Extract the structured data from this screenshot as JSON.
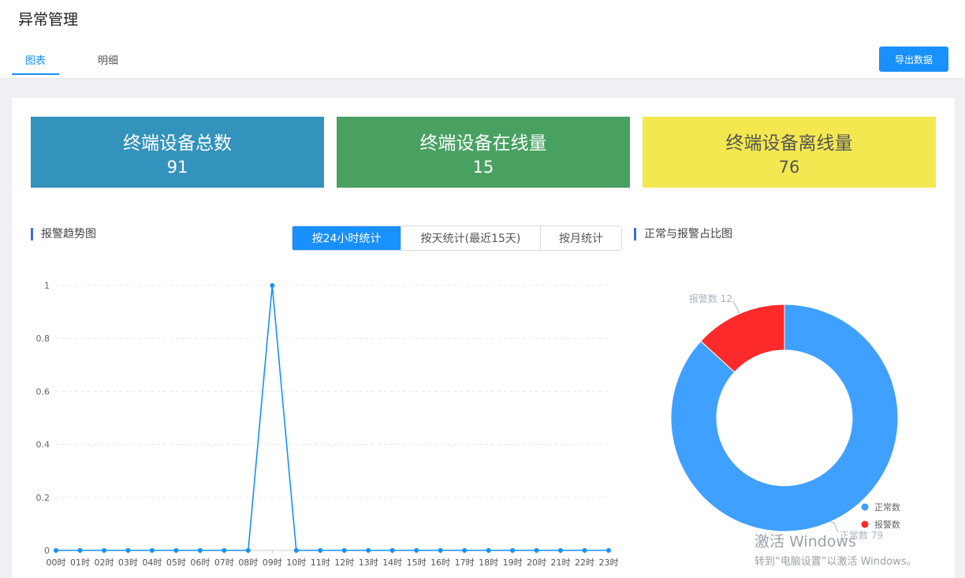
{
  "header": {
    "title": "异常管理",
    "tabs": [
      {
        "label": "图表"
      },
      {
        "label": "明细"
      }
    ],
    "export_label": "导出数据"
  },
  "stats": [
    {
      "label": "终端设备总数",
      "value": "91"
    },
    {
      "label": "终端设备在线量",
      "value": "15"
    },
    {
      "label": "终端设备离线量",
      "value": "76"
    }
  ],
  "sections": {
    "trend_title": "报警趋势图",
    "ratio_title": "正常与报警占比图"
  },
  "segments": [
    "按24小时统计",
    "按天统计(最近15天)",
    "按月统计"
  ],
  "colors": {
    "primary": "#1890ff",
    "total": "#3493bd",
    "online": "#48a161",
    "offline": "#f3e850",
    "normal": "#3fa0ff",
    "alarm": "#fc2a2a"
  },
  "chart_data": [
    {
      "type": "line",
      "x": [
        "00时",
        "01时",
        "02时",
        "03时",
        "04时",
        "05时",
        "06时",
        "07时",
        "08时",
        "09时",
        "10时",
        "11时",
        "12时",
        "13时",
        "14时",
        "15时",
        "16时",
        "17时",
        "18时",
        "19时",
        "20时",
        "21时",
        "22时",
        "23时"
      ],
      "values": [
        0,
        0,
        0,
        0,
        0,
        0,
        0,
        0,
        0,
        1,
        0,
        0,
        0,
        0,
        0,
        0,
        0,
        0,
        0,
        0,
        0,
        0,
        0,
        0
      ],
      "ylim": [
        0,
        1
      ],
      "yticks": [
        "0",
        "0.2",
        "0.4",
        "0.6",
        "0.8",
        "1"
      ],
      "grid": true
    },
    {
      "type": "pie",
      "slices": [
        {
          "name": "正常数",
          "value": 79
        },
        {
          "name": "报警数",
          "value": 12
        }
      ],
      "labels": [
        "正常数 79",
        "报警数 12"
      ],
      "legend": "bottom-right"
    }
  ],
  "watermark": {
    "line1": "激活 Windows",
    "line2": "转到“电脑设置”以激活 Windows。"
  }
}
